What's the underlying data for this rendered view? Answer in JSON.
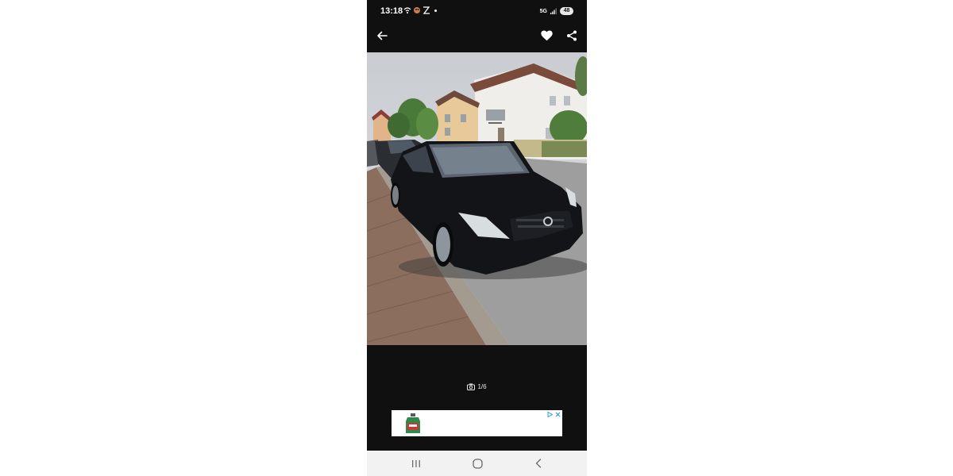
{
  "status_bar": {
    "time": "13:18",
    "left_icons": [
      "wifi-icon",
      "avatar-icon",
      "sync-icon",
      "notification-dot"
    ],
    "network": "5G",
    "battery": "48"
  },
  "app_bar": {
    "icons": [
      "back-arrow-icon",
      "heart-icon",
      "share-icon"
    ],
    "favorite_color": "#ffffff"
  },
  "gallery": {
    "counter_icon": "camera-icon",
    "counter": "1/6",
    "background_color": "#101010"
  },
  "ad": {
    "icons": [
      "adchoices-icon",
      "close-icon"
    ],
    "accent_color": "#1a9ad6"
  },
  "nav_bar": {
    "icons": [
      "recents-icon",
      "home-icon",
      "back-icon"
    ]
  }
}
